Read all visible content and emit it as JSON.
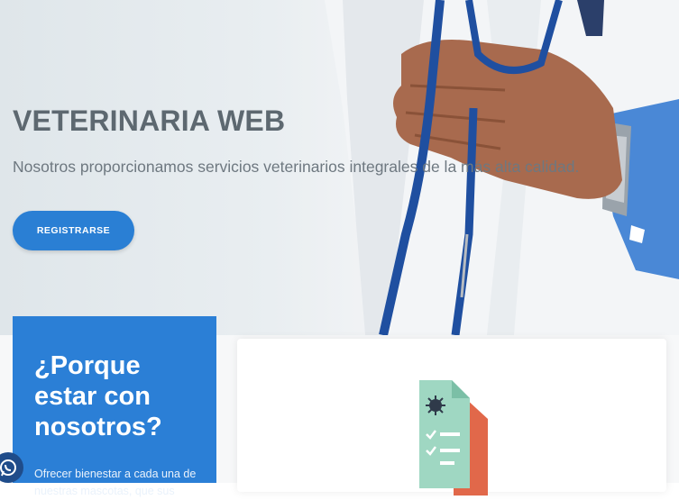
{
  "hero": {
    "title": "VETERINARIA WEB",
    "subtitle": "Nosotros proporcionamos servicios veterinarios integrales de la más alta calidad.",
    "register_button": "REGISTRARSE"
  },
  "why_card": {
    "title": "¿Porque estar con nosotros?",
    "text": "Ofrecer bienestar a cada una de nuestras mascotas, que sus"
  },
  "colors": {
    "accent": "#2b7fd6",
    "title_gray": "#5d6870",
    "coat_white": "#f2f4f6",
    "shirt_blue": "#4a88d6",
    "stethoscope_blue": "#1f4fa0"
  },
  "icons": {
    "feature": "document-virus-checklist-icon",
    "whatsapp": "whatsapp-icon"
  }
}
